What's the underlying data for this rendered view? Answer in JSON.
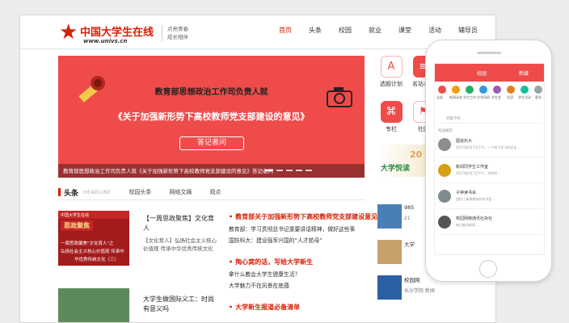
{
  "logo": {
    "name": "中国大学生在线",
    "domain": "www.univs.cn"
  },
  "slogan": [
    "点亮青春",
    "成长相伴"
  ],
  "nav": [
    "首页",
    "头条",
    "校园",
    "就业",
    "课堂",
    "活动",
    "辅导员"
  ],
  "hero": {
    "headline1": "教育部思想政治工作司负责人就",
    "headline2": "《关于加强新形势下高校教师党支部建设的意见》",
    "button": "答记者问",
    "caption": "教育部思想政治工作司负责人就《关于加强新形势下高校教师党支部建设的意见》答记者问"
  },
  "quick_links": [
    {
      "label": "选题计划",
      "icon": "app-store-icon",
      "color": "#ef4b4b"
    },
    {
      "label": "名站名栏",
      "icon": "list-icon",
      "color": "#ef4b4b"
    },
    {
      "label": "专栏",
      "icon": "paperclip-icon",
      "color": "#ef4b4b"
    },
    {
      "label": "社团",
      "icon": "flag-icon",
      "color": "#ef4b4b"
    }
  ],
  "side_banner": {
    "text": "大学悦读",
    "year_fragment": "20"
  },
  "section": {
    "title": "头条",
    "subtitle": "HEADLINE",
    "tabs": [
      "校园头条",
      "网络文摘",
      "观点"
    ]
  },
  "articles": [
    {
      "title": "【一周思政聚焦】文化育人",
      "desc": "【文化育人】弘扬社会主义核心价值观 传承中华优秀传统文化",
      "thumb_top": "中国大学生在线",
      "thumb_badge": "思政聚焦",
      "thumb_lines": [
        "一周思政聚焦\"文化育人\"之",
        "弘扬社会主义核心价值观 传承中",
        "华优秀传统文化（三）"
      ]
    },
    {
      "title": "大学生做国际义工：时尚有意义吗",
      "desc": ""
    }
  ],
  "news_groups": [
    {
      "headline": "教育部关于加强新形势下高校教师党支部建设意见",
      "items": [
        "教育部：学习贯彻总书记重要讲话精神，做好这些事",
        "国防科大：建设强军兴国的“人才航母”"
      ]
    },
    {
      "headline": "掏心窝的话，写给大学新生",
      "items": [
        "拿什么教会大学生健康生活？",
        "大学魅力不在风景在底蕴"
      ]
    },
    {
      "headline": "大学新生报道必备清单",
      "items": []
    }
  ],
  "side_cards": [
    {
      "title": "985",
      "sub": "21"
    },
    {
      "title": "大学",
      "sub": ""
    },
    {
      "title": "校园网",
      "sub": "长沙学院 新闻"
    }
  ],
  "phone": {
    "tabs": [
      "校园",
      "新媒"
    ],
    "icon_labels": [
      "全部",
      "新闻动态",
      "学生工作",
      "学术科研",
      "学生会",
      "社团",
      "学生活动",
      "更多"
    ],
    "search": "印象学校",
    "section": "校园推荐",
    "rows": [
      {
        "title": "图说石大",
        "sub": "2017年6月7日下午，一个关于学习的会议..."
      },
      {
        "title": "新闻同学生工作室",
        "sub": "2017年6月7日下午，学院的..."
      },
      {
        "title": "子钟读书会",
        "sub": "[图片] 每周都有的读书会..."
      },
      {
        "title": "校园网络通讯社杂社",
        "sub": "每日推送新闻..."
      }
    ]
  }
}
